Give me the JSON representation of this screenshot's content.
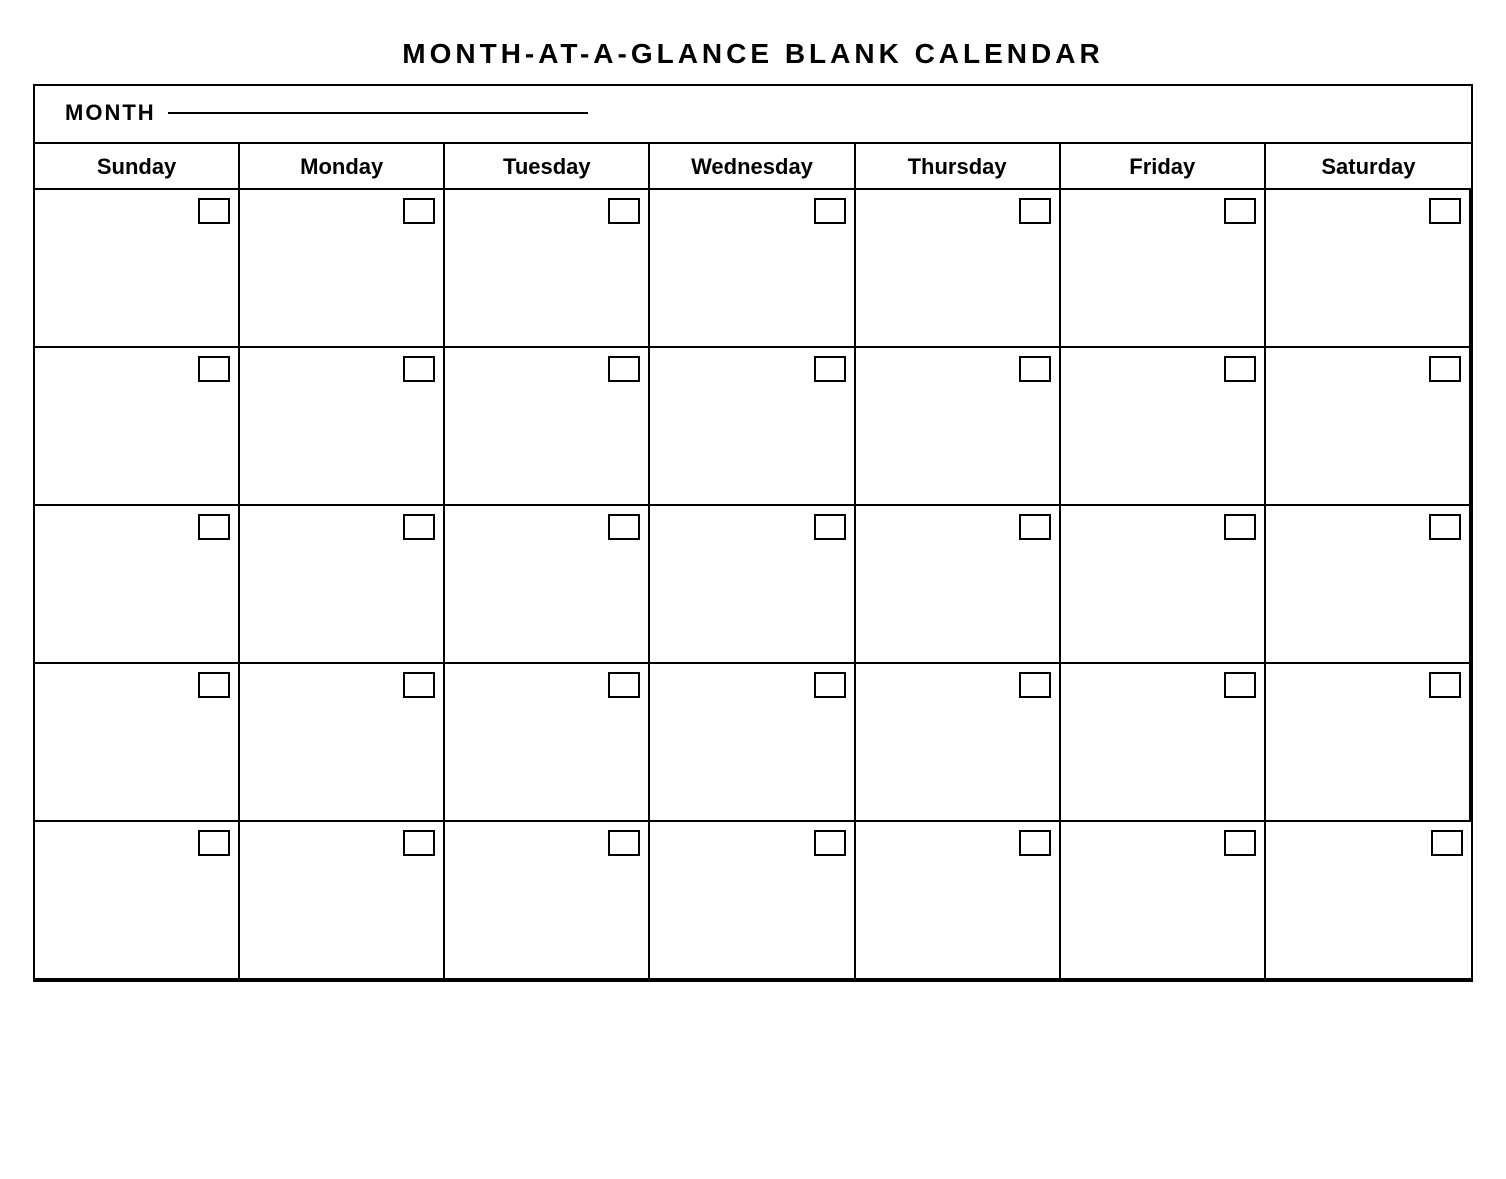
{
  "title": "MONTH-AT-A-GLANCE  BLANK  CALENDAR",
  "month_label": "MONTH",
  "days": [
    "Sunday",
    "Monday",
    "Tuesday",
    "Wednesday",
    "Thursday",
    "Friday",
    "Saturday"
  ],
  "num_weeks": 5
}
